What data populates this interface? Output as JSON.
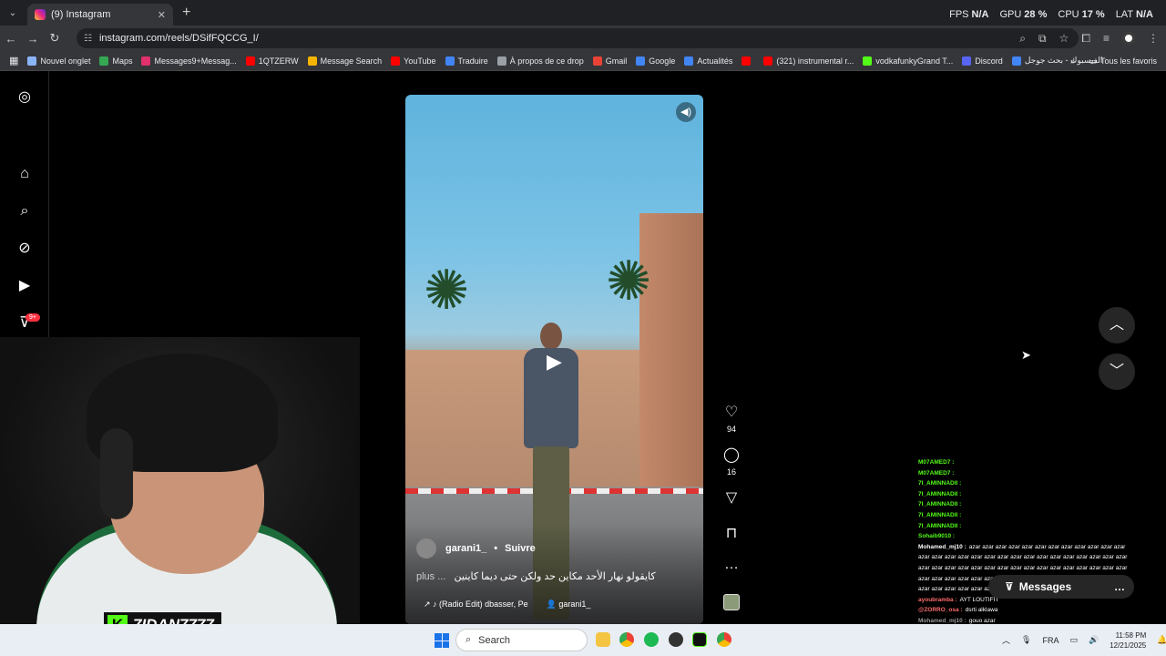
{
  "browser": {
    "tab_title": "(9) Instagram",
    "url": "instagram.com/reels/DSifFQCCG_I/",
    "new_tab_symbol": "+",
    "hud": [
      {
        "key": "FPS",
        "value": "N/A"
      },
      {
        "key": "GPU",
        "value": "28 %"
      },
      {
        "key": "CPU",
        "value": "17 %"
      },
      {
        "key": "LAT",
        "value": "N/A"
      }
    ],
    "bookmarks": [
      {
        "label": "Nouvel onglet",
        "color": "#8ab4f8"
      },
      {
        "label": "Maps",
        "color": "#34a853"
      },
      {
        "label": "Messages9+Messag...",
        "color": "#e1306c"
      },
      {
        "label": "1QTZERW",
        "color": "#ff0000"
      },
      {
        "label": "Message Search",
        "color": "#f4b400"
      },
      {
        "label": "YouTube",
        "color": "#ff0000"
      },
      {
        "label": "Traduire",
        "color": "#4285f4"
      },
      {
        "label": "À propos de ce drop",
        "color": "#9aa0a6"
      },
      {
        "label": "Gmail",
        "color": "#ea4335"
      },
      {
        "label": "Google",
        "color": "#4285f4"
      },
      {
        "label": "Actualités",
        "color": "#4285f4"
      },
      {
        "label": "",
        "color": "#ff0000"
      },
      {
        "label": "(321) instrumental r...",
        "color": "#ff0000"
      },
      {
        "label": "vodkafunkyGrand T...",
        "color": "#53fc18"
      },
      {
        "label": "Discord",
        "color": "#5865f2"
      },
      {
        "label": "الفيسبوك - بحث جوجل",
        "color": "#4285f4"
      }
    ],
    "bookmarks_all": "Tous les favoris"
  },
  "instagram": {
    "notification_badge": "9+",
    "reel": {
      "author": "garani1_",
      "follow_label": "Suivre",
      "caption": "كايقولو نهار الأحد مكاين حد ولكن حتى ديما كاينين",
      "more_label": "plus ...",
      "audio": "(Radio Edit)  dbasser, Pe",
      "tagged_user": "garani1_",
      "likes": "94",
      "comments": "16"
    },
    "messages_label": "Messages"
  },
  "stream": {
    "streamer_name": "7IDAN7777",
    "chat": [
      {
        "user": "M07AMED7 :",
        "text": "",
        "color": "#53fc18"
      },
      {
        "user": "M07AMED7 :",
        "text": "",
        "color": "#53fc18"
      },
      {
        "user": "7I_AMINNADII :",
        "text": "",
        "color": "#53fc18"
      },
      {
        "user": "7I_AMINNADII :",
        "text": "",
        "color": "#53fc18"
      },
      {
        "user": "7I_AMINNADII :",
        "text": "",
        "color": "#53fc18"
      },
      {
        "user": "7I_AMINNADII :",
        "text": "",
        "color": "#53fc18"
      },
      {
        "user": "7I_AMINNADII :",
        "text": "",
        "color": "#53fc18"
      },
      {
        "user": "Sohaib9010 :",
        "text": "",
        "color": "#53fc18"
      },
      {
        "user": "Mohamed_mj10 :",
        "text": "azar azar azar azar azar azar azar azar azar azar azar azar azar azar azar azar azar azar azar azar azar azar azar azar azar azar azar azar azar azar azar azar azar azar azar azar azar azar azar azar azar azar azar azar azar azar azar azar azar azar azar azar azar azar azar azar azar azar azar azar azar azar azar azar azar azar azar azar azar azar azar azar azar azar azar",
        "color": "#ffffff"
      },
      {
        "user": "ayoubramba :",
        "text": "AYT LOUTIFIT",
        "color": "#ff6b6b"
      },
      {
        "user": "@ZORRO_osa :",
        "text": "dsrti alklawa",
        "color": "#ff6b6b"
      },
      {
        "user": "Mohamed_mj10 :",
        "text": "gouo azar",
        "color": "#999999"
      }
    ]
  },
  "taskbar": {
    "search_placeholder": "Search",
    "language": "FRA",
    "time": "11:58 PM",
    "date": "12/21/2025"
  }
}
